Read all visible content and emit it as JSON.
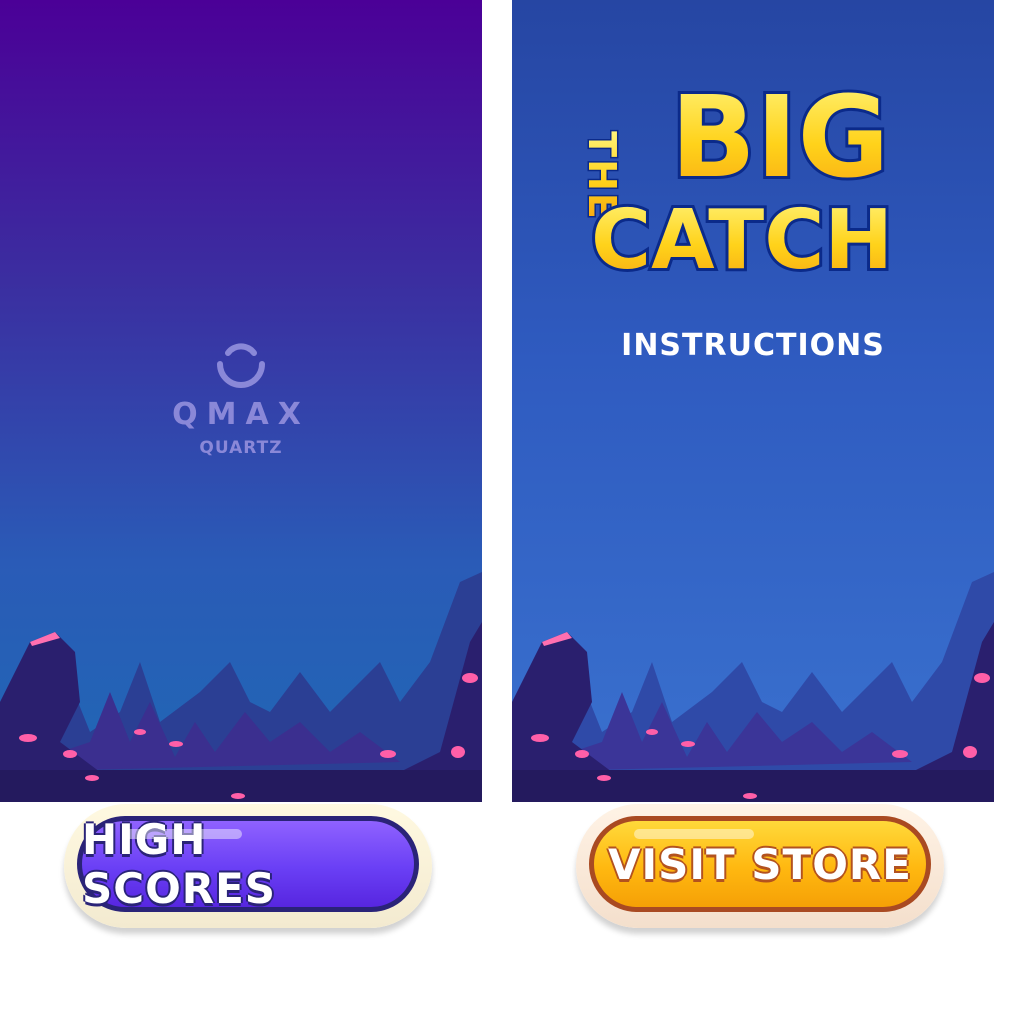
{
  "splash": {
    "logo_name": "QMAX",
    "logo_sub": "QUARTZ"
  },
  "title_screen": {
    "title_small": "THE",
    "title_big": "BIG",
    "title_second": "CATCH",
    "instructions_label": "INSTRUCTIONS"
  },
  "buttons": {
    "high_scores": "HIGH SCORES",
    "visit_store": "VISIT STORE"
  },
  "colors": {
    "splash_top": "#4b0097",
    "title_blue": "#2f5bc0",
    "crystal_pink": "#ff5fa8",
    "title_yellow": "#ffd21a",
    "button_purple": "#6a3ff5",
    "button_yellow": "#ffb810"
  },
  "icons": {
    "logo_mark": "ring-arc-icon"
  }
}
